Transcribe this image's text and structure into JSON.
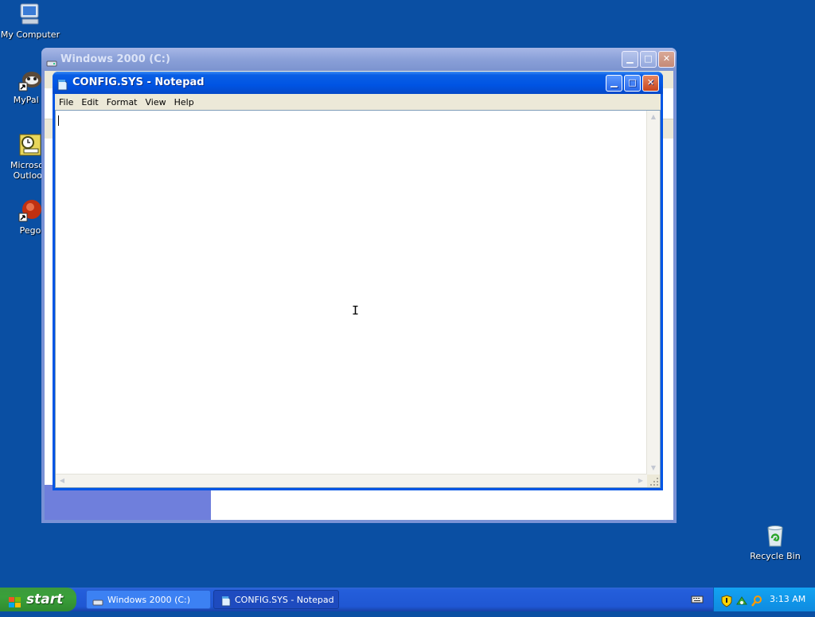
{
  "desktop": {
    "icons": [
      {
        "label": "My Computer",
        "icon": "my-computer-icon"
      },
      {
        "label": "MyPal 6",
        "icon": "mypal-icon"
      },
      {
        "label": "Microsoft Outlook",
        "icon": "outlook-icon"
      },
      {
        "label": "Pego",
        "icon": "pego-icon"
      },
      {
        "label": "Recycle Bin",
        "icon": "recycle-bin-icon"
      }
    ]
  },
  "explorer_window": {
    "title": "Windows 2000 (C:)"
  },
  "notepad": {
    "title": "CONFIG.SYS - Notepad",
    "menu": [
      "File",
      "Edit",
      "Format",
      "View",
      "Help"
    ],
    "content": ""
  },
  "taskbar": {
    "start_label": "start",
    "tasks": [
      {
        "label": "Windows 2000 (C:)",
        "active": false
      },
      {
        "label": "CONFIG.SYS - Notepad",
        "active": true
      }
    ],
    "clock": "3:13 AM"
  },
  "colors": {
    "desktop": "#0a4fa3",
    "titlebar_active": "#0054e3",
    "start_green": "#3aa03a",
    "tray_blue": "#0f8be0"
  }
}
